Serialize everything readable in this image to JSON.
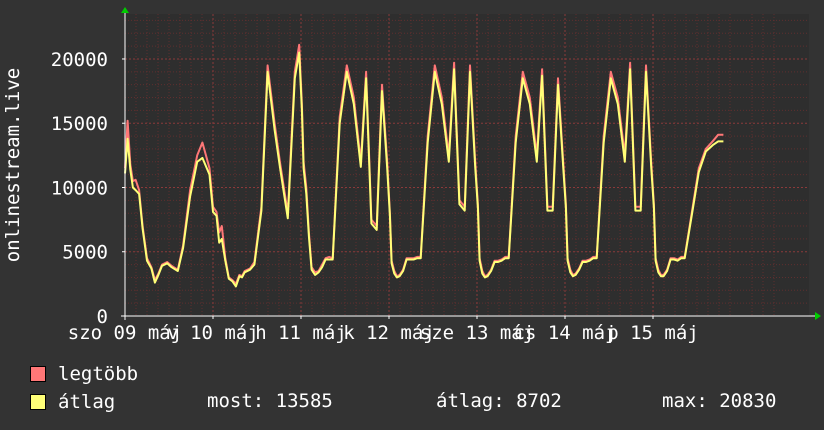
{
  "chart_data": {
    "type": "line",
    "ylabel": "onlinestream.live",
    "ylim": [
      0,
      23500
    ],
    "yticks": [
      0,
      5000,
      10000,
      15000,
      20000
    ],
    "ytick_labels": [
      "0",
      "5000",
      "10000",
      "15000",
      "20000"
    ],
    "xlim": [
      0,
      7.42
    ],
    "xticks": [
      0,
      1,
      2,
      3,
      4,
      5,
      6
    ],
    "xtick_labels": [
      "szo 09 máj",
      "v 10 máj",
      "h 11 máj",
      "k 12 máj",
      "sze 13 máj",
      "cs 14 máj",
      "p 15 máj"
    ],
    "grid": true,
    "legend_position": "bottom-left",
    "colors": {
      "background": "#333333",
      "plot": "#2e2e2e",
      "grid": "#5e2f2f",
      "axis": "#ffffff",
      "series_max": "#ff7777",
      "series_avg": "#ffff77",
      "arrow": "#00cc00"
    },
    "x": [
      0.0,
      0.03,
      0.06,
      0.09,
      0.12,
      0.16,
      0.2,
      0.25,
      0.3,
      0.34,
      0.38,
      0.42,
      0.48,
      0.53,
      0.6,
      0.66,
      0.74,
      0.82,
      0.88,
      0.96,
      1.0,
      1.04,
      1.07,
      1.1,
      1.14,
      1.18,
      1.22,
      1.26,
      1.3,
      1.33,
      1.36,
      1.42,
      1.47,
      1.55,
      1.62,
      1.7,
      1.76,
      1.85,
      1.93,
      1.98,
      2.01,
      2.03,
      2.06,
      2.09,
      2.12,
      2.16,
      2.2,
      2.24,
      2.28,
      2.32,
      2.36,
      2.44,
      2.52,
      2.6,
      2.68,
      2.74,
      2.8,
      2.86,
      2.92,
      2.98,
      3.01,
      3.03,
      3.06,
      3.09,
      3.12,
      3.16,
      3.2,
      3.24,
      3.28,
      3.32,
      3.36,
      3.44,
      3.52,
      3.6,
      3.68,
      3.74,
      3.8,
      3.86,
      3.92,
      3.98,
      4.01,
      4.03,
      4.06,
      4.09,
      4.12,
      4.16,
      4.2,
      4.24,
      4.28,
      4.32,
      4.36,
      4.44,
      4.52,
      4.6,
      4.68,
      4.74,
      4.8,
      4.86,
      4.92,
      4.98,
      5.01,
      5.03,
      5.06,
      5.09,
      5.12,
      5.16,
      5.2,
      5.24,
      5.28,
      5.32,
      5.36,
      5.44,
      5.52,
      5.6,
      5.68,
      5.74,
      5.8,
      5.86,
      5.92,
      5.98,
      6.01,
      6.03,
      6.06,
      6.09,
      6.12,
      6.16,
      6.2,
      6.24,
      6.28,
      6.32,
      6.36,
      6.44,
      6.52,
      6.6,
      6.68,
      6.74,
      6.8,
      6.86,
      6.92,
      6.98,
      7.03,
      7.08,
      7.12,
      7.16,
      7.2,
      7.25,
      7.3,
      7.34,
      7.38,
      7.42
    ],
    "series": [
      {
        "name": "legtöbb",
        "values": [
          11500,
          15200,
          11800,
          10500,
          10600,
          9800,
          7000,
          4500,
          3800,
          2800,
          3300,
          4000,
          4200,
          3900,
          3600,
          5500,
          9800,
          12500,
          13500,
          11500,
          8500,
          8100,
          6500,
          7000,
          4500,
          3000,
          2800,
          2500,
          3200,
          3100,
          3500,
          3700,
          4200,
          8500,
          19500,
          15000,
          12000,
          8000,
          19000,
          21100,
          16500,
          12000,
          10000,
          6500,
          3800,
          3400,
          3500,
          4000,
          4500,
          4600,
          4500,
          15500,
          19500,
          17000,
          12000,
          19000,
          7500,
          7000,
          18000,
          12000,
          8000,
          4300,
          3500,
          3100,
          3200,
          3600,
          4500,
          4500,
          4500,
          4600,
          4600,
          14000,
          19500,
          17000,
          12500,
          19700,
          9000,
          8500,
          19500,
          12000,
          8700,
          4500,
          3500,
          3100,
          3200,
          3600,
          4300,
          4300,
          4400,
          4600,
          4600,
          14000,
          19000,
          17000,
          12500,
          19200,
          8500,
          8500,
          18500,
          12000,
          8700,
          4500,
          3600,
          3200,
          3300,
          3700,
          4300,
          4300,
          4400,
          4600,
          4600,
          14000,
          19000,
          17000,
          12500,
          19700,
          8500,
          8500,
          19500,
          12000,
          8700,
          4500,
          3600,
          3200,
          3200,
          3600,
          4500,
          4500,
          4400,
          4600,
          4600,
          8000,
          11500,
          13000,
          13600,
          14100,
          14100
        ]
      },
      {
        "name": "átlag",
        "values": [
          11100,
          13800,
          11400,
          10000,
          9800,
          9500,
          6800,
          4300,
          3700,
          2600,
          3200,
          3900,
          4100,
          3800,
          3500,
          5300,
          9300,
          12000,
          12300,
          11000,
          8100,
          7800,
          5700,
          6000,
          4300,
          2900,
          2700,
          2300,
          3100,
          3000,
          3400,
          3600,
          4000,
          8200,
          19000,
          14500,
          11600,
          7600,
          18500,
          20500,
          16000,
          11500,
          9500,
          6200,
          3600,
          3200,
          3400,
          3800,
          4400,
          4400,
          4400,
          15000,
          19000,
          16500,
          11600,
          18500,
          7200,
          6700,
          17500,
          11500,
          7800,
          4100,
          3300,
          3000,
          3100,
          3500,
          4400,
          4400,
          4400,
          4500,
          4500,
          13500,
          19000,
          16500,
          12000,
          19200,
          8700,
          8200,
          19000,
          11600,
          8400,
          4300,
          3300,
          3000,
          3100,
          3500,
          4200,
          4200,
          4300,
          4500,
          4500,
          13500,
          18500,
          16500,
          12000,
          18700,
          8200,
          8200,
          18000,
          11600,
          8400,
          4300,
          3400,
          3100,
          3200,
          3600,
          4200,
          4200,
          4300,
          4500,
          4500,
          13500,
          18500,
          16500,
          12000,
          19200,
          8200,
          8200,
          19000,
          11600,
          8400,
          4300,
          3400,
          3100,
          3100,
          3500,
          4400,
          4400,
          4300,
          4500,
          4500,
          7800,
          11200,
          12800,
          13300,
          13585,
          13585
        ]
      }
    ],
    "legend": {
      "max_label": "legtöbb",
      "avg_label": "átlag",
      "now_text": "most: 13585",
      "avg_text": "átlag: 8702",
      "max_text": "max: 20830"
    }
  }
}
